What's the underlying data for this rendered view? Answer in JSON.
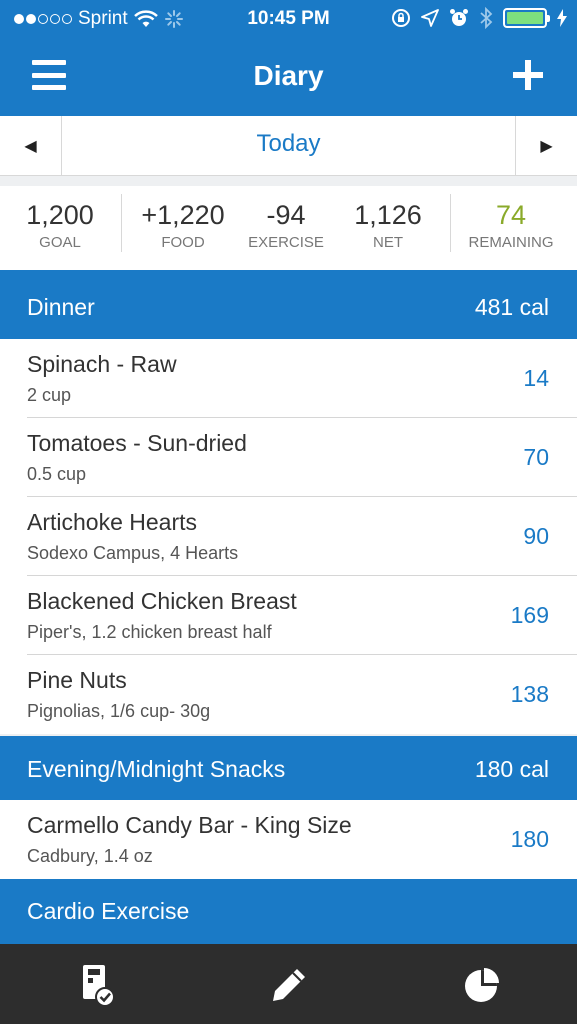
{
  "status_bar": {
    "carrier": "Sprint",
    "time": "10:45 PM",
    "signal_strength": 2,
    "battery_color": "#7ee07e"
  },
  "nav": {
    "title": "Diary",
    "menu_icon": "hamburger-menu-icon",
    "add_icon": "plus-icon"
  },
  "date_bar": {
    "label": "Today",
    "prev_icon": "triangle-left-icon",
    "next_icon": "triangle-right-icon"
  },
  "summary": {
    "goal": {
      "value": "1,200",
      "label": "GOAL"
    },
    "food": {
      "value": "+1,220",
      "label": "FOOD"
    },
    "exercise": {
      "value": "-94",
      "label": "EXERCISE"
    },
    "net": {
      "value": "1,126",
      "label": "NET"
    },
    "remaining": {
      "value": "74",
      "label": "REMAINING",
      "color": "#8aaa2a"
    }
  },
  "sections": [
    {
      "name": "Dinner",
      "calories": "481 cal",
      "entries": [
        {
          "name": "Spinach - Raw",
          "detail": "2 cup",
          "calories": "14"
        },
        {
          "name": "Tomatoes - Sun-dried",
          "detail": "0.5 cup",
          "calories": "70"
        },
        {
          "name": "Artichoke Hearts",
          "detail": "Sodexo Campus, 4 Hearts",
          "calories": "90"
        },
        {
          "name": "Blackened Chicken Breast",
          "detail": "Piper's, 1.2 chicken breast half",
          "calories": "169"
        },
        {
          "name": "Pine Nuts",
          "detail": "Pignolias, 1/6 cup- 30g",
          "calories": "138"
        }
      ]
    },
    {
      "name": "Evening/Midnight Snacks",
      "calories": "180 cal",
      "entries": [
        {
          "name": "Carmello Candy Bar - King Size",
          "detail": "Cadbury, 1.4 oz",
          "calories": "180"
        }
      ]
    },
    {
      "name": "Cardio Exercise",
      "calories": "",
      "entries": []
    }
  ],
  "tab_bar": {
    "items": [
      {
        "icon": "diary-check-icon"
      },
      {
        "icon": "pencil-icon"
      },
      {
        "icon": "pie-chart-icon"
      }
    ]
  },
  "colors": {
    "primary": "#1a7ac6",
    "tab_bar": "#2d2d2d",
    "remaining": "#8aaa2a"
  }
}
